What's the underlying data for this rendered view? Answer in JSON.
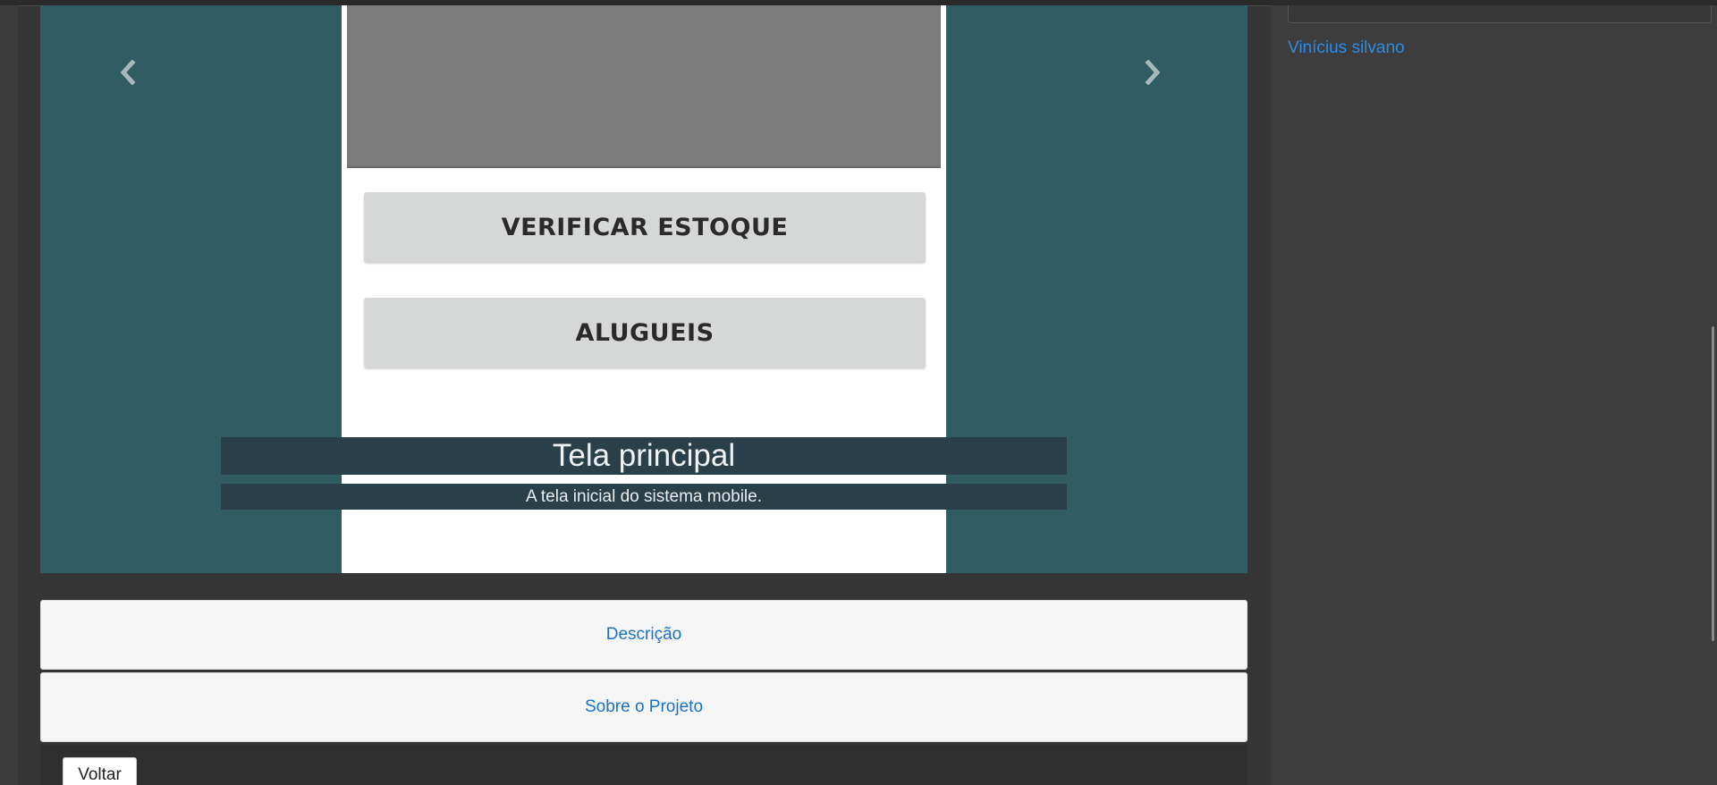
{
  "carousel": {
    "slide": {
      "buttons": [
        "VERIFICAR ESTOQUE",
        "ALUGUEIS"
      ],
      "caption_title": "Tela principal",
      "caption_text": "A tela inicial do sistema mobile."
    },
    "prev_icon": "chevron-left-icon",
    "next_icon": "chevron-right-icon"
  },
  "panels": {
    "description": "Descrição",
    "about": "Sobre o Projeto"
  },
  "back_button": "Voltar",
  "sidebar": {
    "author": "Vinícius silvano"
  },
  "colors": {
    "page_bg": "#353535",
    "carousel_bg": "#325c63",
    "caption_bg": "#29404b",
    "link": "#1a73c8",
    "sidebar_bg": "#3d3d3d"
  }
}
